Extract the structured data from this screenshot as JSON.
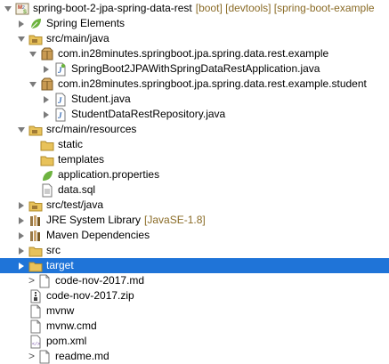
{
  "tree": [
    {
      "depth": 0,
      "twisty": "down",
      "icon": "maven-project-icon",
      "label": "spring-boot-2-jpa-spring-data-rest",
      "decoration": "[boot] [devtools] [spring-boot-example",
      "prefix": ""
    },
    {
      "depth": 1,
      "twisty": "right",
      "icon": "spring-leaf-icon",
      "label": "Spring Elements",
      "decoration": "",
      "prefix": ""
    },
    {
      "depth": 1,
      "twisty": "down",
      "icon": "source-folder-icon",
      "label": "src/main/java",
      "decoration": "",
      "prefix": ""
    },
    {
      "depth": 2,
      "twisty": "down",
      "icon": "package-icon",
      "label": "com.in28minutes.springboot.jpa.spring.data.rest.example",
      "decoration": "",
      "prefix": ""
    },
    {
      "depth": 3,
      "twisty": "right",
      "icon": "java-spring-file-icon",
      "label": "SpringBoot2JPAWithSpringDataRestApplication.java",
      "decoration": "",
      "prefix": ""
    },
    {
      "depth": 2,
      "twisty": "down",
      "icon": "package-icon",
      "label": "com.in28minutes.springboot.jpa.spring.data.rest.example.student",
      "decoration": "",
      "prefix": ""
    },
    {
      "depth": 3,
      "twisty": "right",
      "icon": "java-file-icon",
      "label": "Student.java",
      "decoration": "",
      "prefix": ""
    },
    {
      "depth": 3,
      "twisty": "right",
      "icon": "java-file-icon",
      "label": "StudentDataRestRepository.java",
      "decoration": "",
      "prefix": ""
    },
    {
      "depth": 1,
      "twisty": "down",
      "icon": "source-folder-icon",
      "label": "src/main/resources",
      "decoration": "",
      "prefix": ""
    },
    {
      "depth": 2,
      "twisty": "none",
      "icon": "folder-icon",
      "label": "static",
      "decoration": "",
      "prefix": ""
    },
    {
      "depth": 2,
      "twisty": "none",
      "icon": "folder-icon",
      "label": "templates",
      "decoration": "",
      "prefix": ""
    },
    {
      "depth": 2,
      "twisty": "none",
      "icon": "spring-properties-icon",
      "label": "application.properties",
      "decoration": "",
      "prefix": ""
    },
    {
      "depth": 2,
      "twisty": "none",
      "icon": "sql-file-icon",
      "label": "data.sql",
      "decoration": "",
      "prefix": ""
    },
    {
      "depth": 1,
      "twisty": "right",
      "icon": "source-folder-icon",
      "label": "src/test/java",
      "decoration": "",
      "prefix": ""
    },
    {
      "depth": 1,
      "twisty": "right",
      "icon": "library-icon",
      "label": "JRE System Library",
      "decoration": "[JavaSE-1.8]",
      "prefix": ""
    },
    {
      "depth": 1,
      "twisty": "right",
      "icon": "library-icon",
      "label": "Maven Dependencies",
      "decoration": "",
      "prefix": ""
    },
    {
      "depth": 1,
      "twisty": "right",
      "icon": "folder-icon",
      "label": "src",
      "decoration": "",
      "prefix": ""
    },
    {
      "depth": 1,
      "twisty": "right",
      "icon": "folder-icon",
      "label": "target",
      "decoration": "",
      "prefix": "",
      "selected": true
    },
    {
      "depth": 1,
      "twisty": "none",
      "icon": "file-icon",
      "label": "code-nov-2017.md",
      "decoration": "",
      "prefix": ">"
    },
    {
      "depth": 1,
      "twisty": "none",
      "icon": "zip-file-icon",
      "label": "code-nov-2017.zip",
      "decoration": "",
      "prefix": ""
    },
    {
      "depth": 1,
      "twisty": "none",
      "icon": "file-icon",
      "label": "mvnw",
      "decoration": "",
      "prefix": ""
    },
    {
      "depth": 1,
      "twisty": "none",
      "icon": "file-icon",
      "label": "mvnw.cmd",
      "decoration": "",
      "prefix": ""
    },
    {
      "depth": 1,
      "twisty": "none",
      "icon": "xml-file-icon",
      "label": "pom.xml",
      "decoration": "",
      "prefix": ""
    },
    {
      "depth": 1,
      "twisty": "none",
      "icon": "file-icon",
      "label": "readme.md",
      "decoration": "",
      "prefix": ">"
    }
  ],
  "colors": {
    "selection": "#1f74d8",
    "decoration": "#8a6b26",
    "folder": "#e8c25a",
    "java": "#3b6fb6",
    "spring": "#6db33f"
  }
}
